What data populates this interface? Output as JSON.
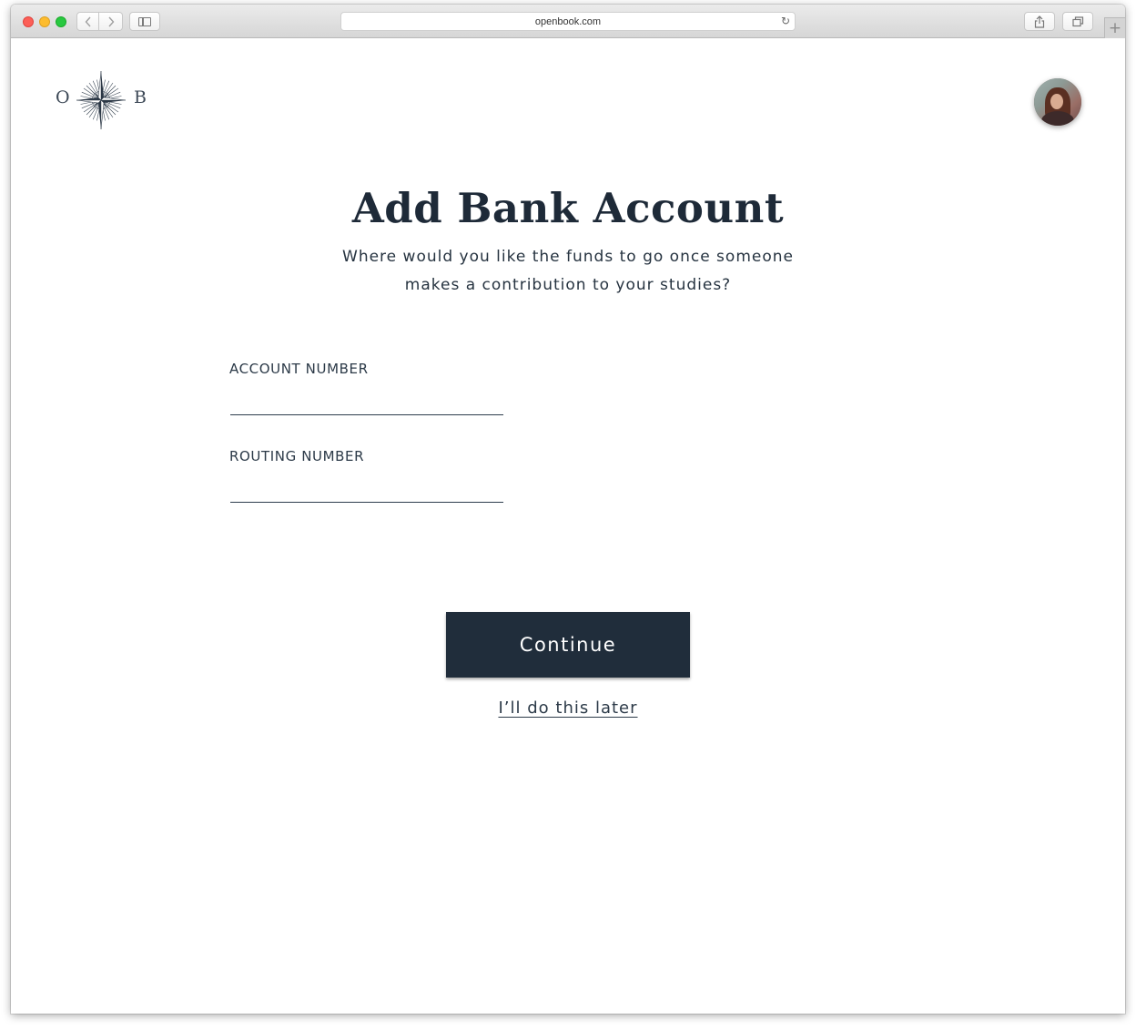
{
  "browser": {
    "url": "openbook.com",
    "back_icon": "chevron-left-icon",
    "forward_icon": "chevron-right-icon",
    "reload_icon": "reload-icon",
    "new_tab_label": "+"
  },
  "brand": {
    "letter_left": "O",
    "letter_right": "B",
    "emblem": "compass-rose-icon",
    "color": "#3c4856"
  },
  "page": {
    "title": "Add Bank Account",
    "subtitle_line1": "Where would you like the funds to go once someone",
    "subtitle_line2": "makes a contribution to your studies?"
  },
  "form": {
    "account_number": {
      "label": "ACCOUNT NUMBER",
      "value": "",
      "placeholder": ""
    },
    "routing_number": {
      "label": "ROUTING NUMBER",
      "value": "",
      "placeholder": ""
    }
  },
  "actions": {
    "continue_label": "Continue",
    "later_label": "I’ll do this later",
    "button_color": "#202d3b"
  }
}
